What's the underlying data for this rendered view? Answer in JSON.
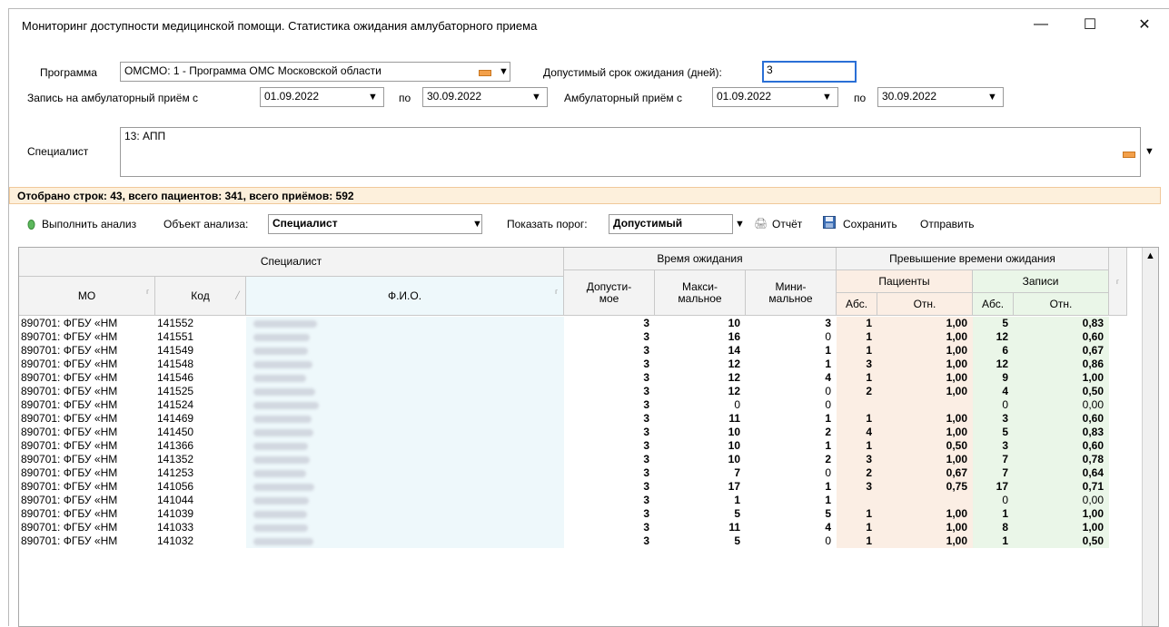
{
  "window": {
    "title": "Мониторинг доступности медицинской помощи. Статистика ожидания амлубаторного приема",
    "minimize": "—",
    "maximize": "☐",
    "close": "✕"
  },
  "filters": {
    "program_label": "Программа",
    "program_value": "ОМСМО: 1 - Программа ОМС Московской области",
    "wait_label": "Допустимый срок ожидания (дней):",
    "wait_value": "3",
    "appt_label": "Запись на амбулаторный приём с",
    "appt_from": "01.09.2022",
    "po1": "по",
    "appt_to": "30.09.2022",
    "visit_label": "Амбулаторный приём с",
    "visit_from": "01.09.2022",
    "po2": "по",
    "visit_to": "30.09.2022",
    "specialist_label": "Специалист",
    "specialist_value": "13: АПП"
  },
  "summary": "Отобрано строк: 43, всего пациентов: 341, всего приёмов: 592",
  "toolbar": {
    "run": "Выполнить анализ",
    "object_label": "Объект анализа:",
    "object_value": "Специалист",
    "threshold_label": "Показать порог:",
    "threshold_value": "Допустимый",
    "report": "Отчёт",
    "save": "Сохранить",
    "send": "Отправить"
  },
  "grid": {
    "group_specialist": "Специалист",
    "group_wait": "Время ожидания",
    "group_excess": "Превышение времени ожидания",
    "sub_patients": "Пациенты",
    "sub_records": "Записи",
    "col_mo": "МО",
    "col_code": "Код",
    "col_fio": "Ф.И.О.",
    "col_allowed": "Допусти-\nмое",
    "col_max": "Макси-\nмальное",
    "col_min": "Мини-\nмальное",
    "col_p_abs": "Абс.",
    "col_p_rel": "Отн.",
    "col_r_abs": "Абс.",
    "col_r_rel": "Отн.",
    "rows": [
      {
        "mo": "890701: ФГБУ «НМ",
        "code": "141552",
        "allowed": "3",
        "max": "10",
        "min": "3",
        "pa": "1",
        "pr": "1,00",
        "ra": "5",
        "rr": "0,83"
      },
      {
        "mo": "890701: ФГБУ «НМ",
        "code": "141551",
        "allowed": "3",
        "max": "16",
        "min": "0",
        "pa": "1",
        "pr": "1,00",
        "ra": "12",
        "rr": "0,60"
      },
      {
        "mo": "890701: ФГБУ «НМ",
        "code": "141549",
        "allowed": "3",
        "max": "14",
        "min": "1",
        "pa": "1",
        "pr": "1,00",
        "ra": "6",
        "rr": "0,67"
      },
      {
        "mo": "890701: ФГБУ «НМ",
        "code": "141548",
        "allowed": "3",
        "max": "12",
        "min": "1",
        "pa": "3",
        "pr": "1,00",
        "ra": "12",
        "rr": "0,86"
      },
      {
        "mo": "890701: ФГБУ «НМ",
        "code": "141546",
        "allowed": "3",
        "max": "12",
        "min": "4",
        "pa": "1",
        "pr": "1,00",
        "ra": "9",
        "rr": "1,00"
      },
      {
        "mo": "890701: ФГБУ «НМ",
        "code": "141525",
        "allowed": "3",
        "max": "12",
        "min": "0",
        "pa": "2",
        "pr": "1,00",
        "ra": "4",
        "rr": "0,50"
      },
      {
        "mo": "890701: ФГБУ «НМ",
        "code": "141524",
        "allowed": "3",
        "max": "0",
        "min": "0",
        "pa": "",
        "pr": "",
        "ra": "0",
        "rr": "0,00"
      },
      {
        "mo": "890701: ФГБУ «НМ",
        "code": "141469",
        "allowed": "3",
        "max": "11",
        "min": "1",
        "pa": "1",
        "pr": "1,00",
        "ra": "3",
        "rr": "0,60"
      },
      {
        "mo": "890701: ФГБУ «НМ",
        "code": "141450",
        "allowed": "3",
        "max": "10",
        "min": "2",
        "pa": "4",
        "pr": "1,00",
        "ra": "5",
        "rr": "0,83"
      },
      {
        "mo": "890701: ФГБУ «НМ",
        "code": "141366",
        "allowed": "3",
        "max": "10",
        "min": "1",
        "pa": "1",
        "pr": "0,50",
        "ra": "3",
        "rr": "0,60"
      },
      {
        "mo": "890701: ФГБУ «НМ",
        "code": "141352",
        "allowed": "3",
        "max": "10",
        "min": "2",
        "pa": "3",
        "pr": "1,00",
        "ra": "7",
        "rr": "0,78"
      },
      {
        "mo": "890701: ФГБУ «НМ",
        "code": "141253",
        "allowed": "3",
        "max": "7",
        "min": "0",
        "pa": "2",
        "pr": "0,67",
        "ra": "7",
        "rr": "0,64"
      },
      {
        "mo": "890701: ФГБУ «НМ",
        "code": "141056",
        "allowed": "3",
        "max": "17",
        "min": "1",
        "pa": "3",
        "pr": "0,75",
        "ra": "17",
        "rr": "0,71"
      },
      {
        "mo": "890701: ФГБУ «НМ",
        "code": "141044",
        "allowed": "3",
        "max": "1",
        "min": "1",
        "pa": "",
        "pr": "",
        "ra": "0",
        "rr": "0,00"
      },
      {
        "mo": "890701: ФГБУ «НМ",
        "code": "141039",
        "allowed": "3",
        "max": "5",
        "min": "5",
        "pa": "1",
        "pr": "1,00",
        "ra": "1",
        "rr": "1,00"
      },
      {
        "mo": "890701: ФГБУ «НМ",
        "code": "141033",
        "allowed": "3",
        "max": "11",
        "min": "4",
        "pa": "1",
        "pr": "1,00",
        "ra": "8",
        "rr": "1,00"
      },
      {
        "mo": "890701: ФГБУ «НМ",
        "code": "141032",
        "allowed": "3",
        "max": "5",
        "min": "0",
        "pa": "1",
        "pr": "1,00",
        "ra": "1",
        "rr": "0,50"
      }
    ]
  },
  "colors": {
    "patients_bg": "#fbeee4",
    "records_bg": "#eaf6e8",
    "fio_bg": "#eef8fb",
    "accent_focus": "#2a6fd6"
  }
}
